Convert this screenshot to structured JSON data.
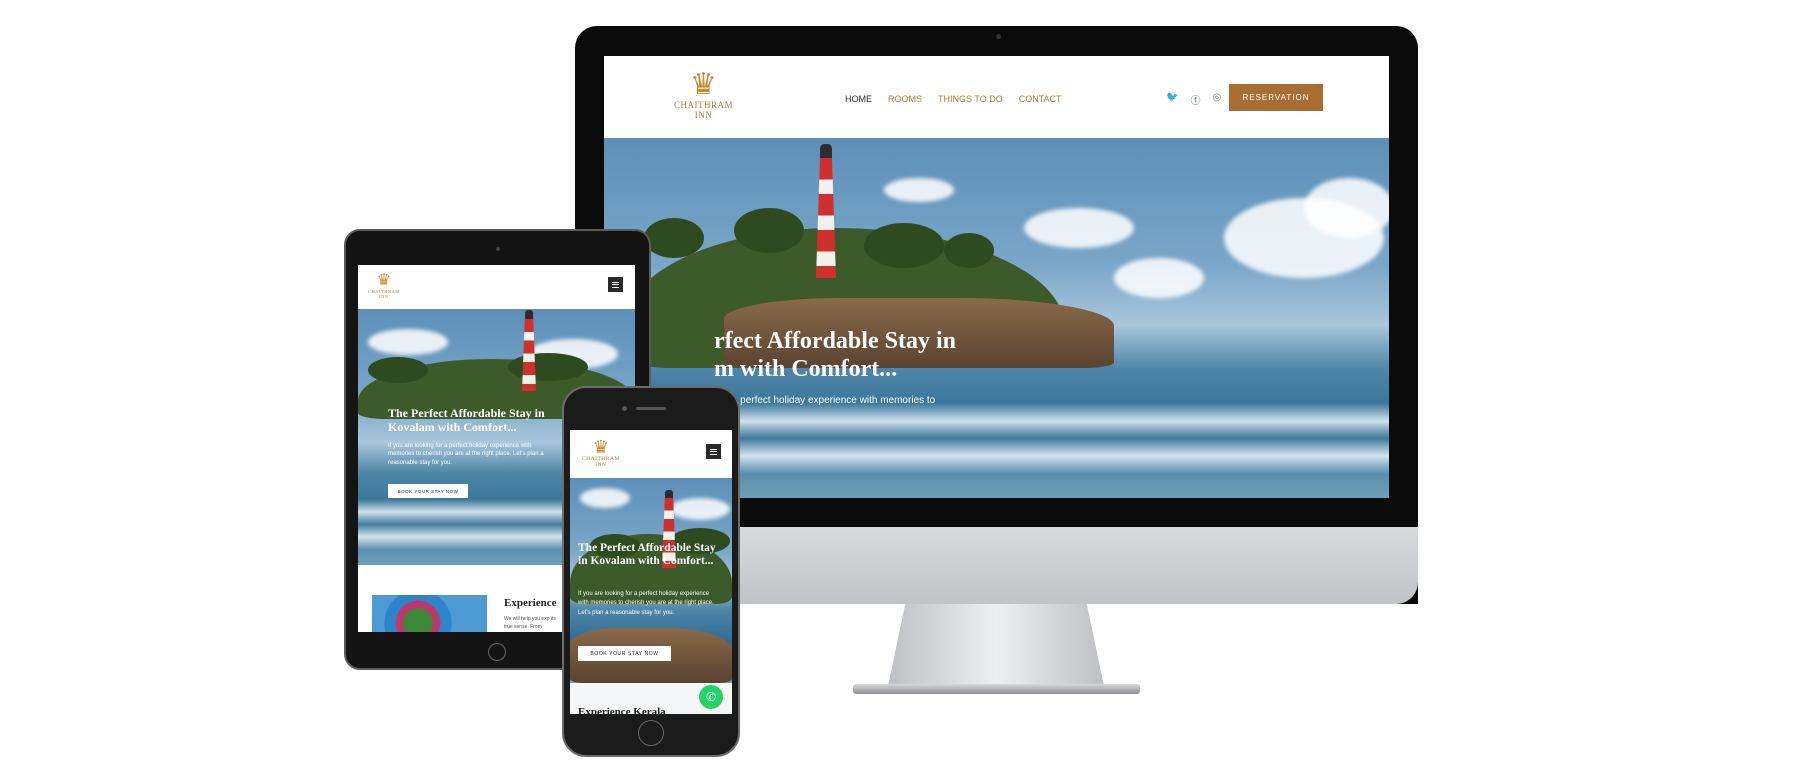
{
  "brand": {
    "line1": "CHAITHRAM",
    "line2": "INN",
    "crown_icon": "♛"
  },
  "desktop": {
    "nav": [
      "HOME",
      "ROOMS",
      "THINGS TO DO",
      "CONTACT"
    ],
    "social_icons": [
      "twitter-icon",
      "facebook-icon",
      "instagram-icon"
    ],
    "reservation_label": "RESERVATION",
    "hero_title_line1": "rfect Affordable Stay in",
    "hero_title_line2": "m with Comfort...",
    "hero_sub": "g for a perfect holiday experience with memories to"
  },
  "tablet": {
    "hero_title": "The Perfect Affordable Stay in Kovalam with Comfort...",
    "hero_sub": "If you are looking for a perfect holiday experience with memories to cherish you are at the right place. Let's plan a reasonable stay for you.",
    "cta_label": "BOOK YOUR STAY NOW",
    "section_title": "Experience",
    "section_sub": "We will help you exp its true sense. From"
  },
  "phone": {
    "hero_title": "The Perfect Affordable Stay in Kovalam with Comfort...",
    "hero_sub": "If you are looking for a perfect holiday experience with memories to cherish you are at the right place. Let's plan a reasonable stay for you.",
    "cta_label": "BOOK YOUR STAY NOW",
    "lower_text": "Experience Kerala"
  },
  "colors": {
    "accent": "#a86d32",
    "brand_text": "#b07a35",
    "whatsapp": "#25d366"
  }
}
